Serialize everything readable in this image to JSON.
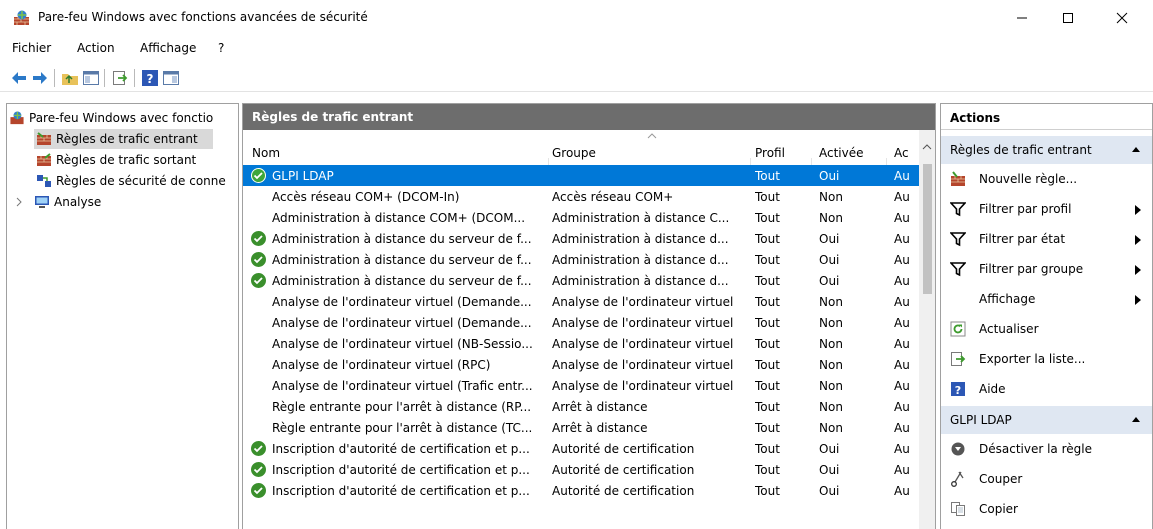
{
  "window": {
    "title": "Pare-feu Windows avec fonctions avancées de sécurité",
    "icon": "firewall-icon"
  },
  "menu": [
    "Fichier",
    "Action",
    "Affichage",
    "?"
  ],
  "tree": {
    "root": "Pare-feu Windows avec fonctio",
    "items": [
      {
        "label": "Règles de trafic entrant",
        "selected": true
      },
      {
        "label": "Règles de trafic sortant"
      },
      {
        "label": "Règles de sécurité de conne"
      },
      {
        "label": "Analyse"
      }
    ]
  },
  "center": {
    "header": "Règles de trafic entrant",
    "columns": [
      "Nom",
      "Groupe",
      "Profil",
      "Activée",
      "Ac"
    ],
    "rows": [
      {
        "name": "GLPI LDAP",
        "group": "",
        "profile": "Tout",
        "enabled": "Oui",
        "action": "Au",
        "check": true,
        "selected": true
      },
      {
        "name": "Accès réseau COM+ (DCOM-In)",
        "group": "Accès réseau COM+",
        "profile": "Tout",
        "enabled": "Non",
        "action": "Au",
        "check": false
      },
      {
        "name": "Administration à distance COM+ (DCOM...",
        "group": "Administration à distance C...",
        "profile": "Tout",
        "enabled": "Non",
        "action": "Au",
        "check": false
      },
      {
        "name": "Administration à distance du serveur de f...",
        "group": "Administration à distance d...",
        "profile": "Tout",
        "enabled": "Oui",
        "action": "Au",
        "check": true
      },
      {
        "name": "Administration à distance du serveur de f...",
        "group": "Administration à distance d...",
        "profile": "Tout",
        "enabled": "Oui",
        "action": "Au",
        "check": true
      },
      {
        "name": "Administration à distance du serveur de f...",
        "group": "Administration à distance d...",
        "profile": "Tout",
        "enabled": "Oui",
        "action": "Au",
        "check": true
      },
      {
        "name": "Analyse de l'ordinateur virtuel (Demande...",
        "group": "Analyse de l'ordinateur virtuel",
        "profile": "Tout",
        "enabled": "Non",
        "action": "Au",
        "check": false
      },
      {
        "name": "Analyse de l'ordinateur virtuel (Demande...",
        "group": "Analyse de l'ordinateur virtuel",
        "profile": "Tout",
        "enabled": "Non",
        "action": "Au",
        "check": false
      },
      {
        "name": "Analyse de l'ordinateur virtuel (NB-Sessio...",
        "group": "Analyse de l'ordinateur virtuel",
        "profile": "Tout",
        "enabled": "Non",
        "action": "Au",
        "check": false
      },
      {
        "name": "Analyse de l'ordinateur virtuel (RPC)",
        "group": "Analyse de l'ordinateur virtuel",
        "profile": "Tout",
        "enabled": "Non",
        "action": "Au",
        "check": false
      },
      {
        "name": "Analyse de l'ordinateur virtuel (Trafic entr...",
        "group": "Analyse de l'ordinateur virtuel",
        "profile": "Tout",
        "enabled": "Non",
        "action": "Au",
        "check": false
      },
      {
        "name": "Règle entrante pour l'arrêt à distance (RP...",
        "group": "Arrêt à distance",
        "profile": "Tout",
        "enabled": "Non",
        "action": "Au",
        "check": false
      },
      {
        "name": "Règle entrante pour l'arrêt à distance (TC...",
        "group": "Arrêt à distance",
        "profile": "Tout",
        "enabled": "Non",
        "action": "Au",
        "check": false
      },
      {
        "name": "Inscription d'autorité de certification et p...",
        "group": "Autorité de certification",
        "profile": "Tout",
        "enabled": "Oui",
        "action": "Au",
        "check": true
      },
      {
        "name": "Inscription d'autorité de certification et p...",
        "group": "Autorité de certification",
        "profile": "Tout",
        "enabled": "Oui",
        "action": "Au",
        "check": true
      },
      {
        "name": "Inscription d'autorité de certification et p...",
        "group": "Autorité de certification",
        "profile": "Tout",
        "enabled": "Oui",
        "action": "Au",
        "check": true
      }
    ]
  },
  "actions": {
    "title": "Actions",
    "section1": "Règles de trafic entrant",
    "items1": [
      {
        "label": "Nouvelle règle...",
        "icon": "new-rule-icon",
        "submenu": false
      },
      {
        "label": "Filtrer par profil",
        "icon": "filter-icon",
        "submenu": true
      },
      {
        "label": "Filtrer par état",
        "icon": "filter-icon",
        "submenu": true
      },
      {
        "label": "Filtrer par groupe",
        "icon": "filter-icon",
        "submenu": true
      },
      {
        "label": "Affichage",
        "icon": "",
        "submenu": true
      },
      {
        "label": "Actualiser",
        "icon": "refresh-icon",
        "submenu": false
      },
      {
        "label": "Exporter la liste...",
        "icon": "export-icon",
        "submenu": false
      },
      {
        "label": "Aide",
        "icon": "help-icon",
        "submenu": false
      }
    ],
    "section2": "GLPI LDAP",
    "items2": [
      {
        "label": "Désactiver la règle",
        "icon": "disable-icon",
        "submenu": false
      },
      {
        "label": "Couper",
        "icon": "cut-icon",
        "submenu": false
      },
      {
        "label": "Copier",
        "icon": "copy-icon",
        "submenu": false
      }
    ]
  },
  "colors": {
    "selection": "#0078d7",
    "header": "#6d6d6d",
    "section": "#dfe7f2",
    "check": "#3a8f2c"
  }
}
